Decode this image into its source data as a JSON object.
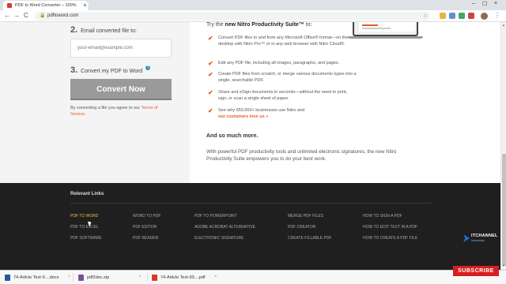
{
  "browser": {
    "tab_title": "PDF to Word Converter – 100%",
    "tab_close": "×",
    "new_tab": "+",
    "url": "pdftoword.com",
    "back": "←",
    "forward": "→",
    "reload": "C",
    "lock": "🔒",
    "star": "☆",
    "menu": "⋮",
    "minimize": "–",
    "maximize": "☐",
    "close": "×"
  },
  "converter": {
    "step2_num": "2.",
    "step2_label": "Email converted file to:",
    "email_placeholder": "your-email@example.com",
    "step3_num": "3.",
    "step3_label": "Convert my PDF to Word",
    "help": "?",
    "convert_button": "Convert Now",
    "terms_prefix": "By converting a file you agree to our ",
    "terms_link": "Terms of Service",
    "terms_suffix": "."
  },
  "promo": {
    "intro_prefix": "Try the ",
    "intro_bold": "new Nitro Productivity Suite™",
    "intro_suffix": " to:",
    "check": "✔",
    "features": [
      "Convert PDF files to and from any Microsoft Office® format—on the desktop with Nitro Pro™ or in any web browser with Nitro Cloud®.",
      "Edit any PDF file, including all images, paragraphs, and pages.",
      "Create PDF files from scratch, or merge various documents types into a single, searchable PDF.",
      "Share and eSign documents in seconds—without the need to print, sign, or scan a single sheet of paper."
    ],
    "feature5_text": "See why 650,000+ businesses use Nitro and",
    "feature5_link": "our customers love us »",
    "more_heading": "And so much more.",
    "more_text": "With powerful PDF productivity tools and unlimited electronic signatures, the new Nitro Productivity Suite empowers you to do your best work."
  },
  "footer": {
    "title": "Relevant Links",
    "col1": [
      "PDF TO WORD",
      "PDF TO EXCEL",
      "PDF SOFTWARE"
    ],
    "col2": [
      "WORD TO PDF",
      "PDF EDITOR",
      "PDF READER"
    ],
    "col3": [
      "PDF TO POWERPOINT",
      "ADOBE ACROBAT ALTERNATIVE",
      "ELECTRONIC SIGNATURE"
    ],
    "col4": [
      "MERGE PDF FILES",
      "PDF CREATOR",
      "CREATE FILLABLE PDF"
    ],
    "col5": [
      "HOW TO SIGN A PDF",
      "HOW TO EDIT TEXT IN A PDF",
      "HOW TO CREATE A PDF FILE"
    ],
    "active_link_color": "#f3c23f"
  },
  "overlay": {
    "logo_text": "ITCHANNEL",
    "logo_sub": "Indonesia",
    "subscribe": "SUBSCRIBE"
  },
  "downloads": [
    {
      "name": "74-Article Text-9....docx",
      "color": "#2b579a"
    },
    {
      "name": "pdf2doc.zip",
      "color": "#7a4f9e"
    },
    {
      "name": "74-Article Text-93....pdf",
      "color": "#d63b2f"
    }
  ],
  "downloads_caret": "^",
  "scroll_up": "▲",
  "scroll_down": "▼",
  "colors": {
    "accent": "#e25e2b",
    "footer_bg": "#1f1f1f",
    "button_gray": "#9a9a9a"
  }
}
